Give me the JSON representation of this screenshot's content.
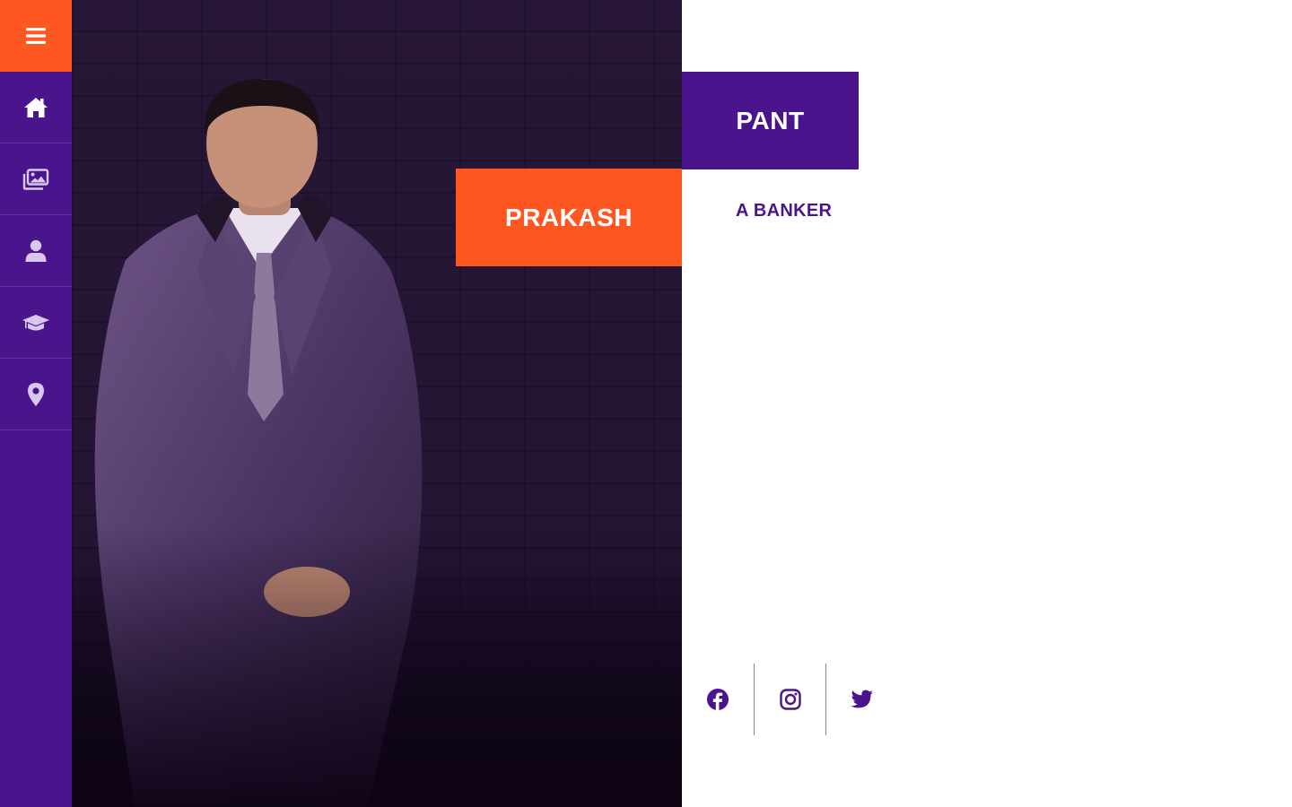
{
  "sidebar": {
    "menu_icon": "hamburger-icon",
    "items": [
      {
        "id": "home",
        "icon": "home-icon"
      },
      {
        "id": "gallery",
        "icon": "images-icon"
      },
      {
        "id": "about",
        "icon": "user-icon"
      },
      {
        "id": "education",
        "icon": "graduation-cap-icon"
      },
      {
        "id": "contact",
        "icon": "map-marker-icon"
      }
    ]
  },
  "hero": {
    "first_name": "PRAKASH",
    "last_name": "PANT",
    "role": "A BANKER"
  },
  "socials": [
    {
      "id": "facebook",
      "icon": "facebook-icon"
    },
    {
      "id": "instagram",
      "icon": "instagram-icon"
    },
    {
      "id": "twitter",
      "icon": "twitter-icon"
    }
  ],
  "colors": {
    "primary_purple": "#4a148c",
    "accent_orange": "#ff5722",
    "white": "#ffffff"
  }
}
